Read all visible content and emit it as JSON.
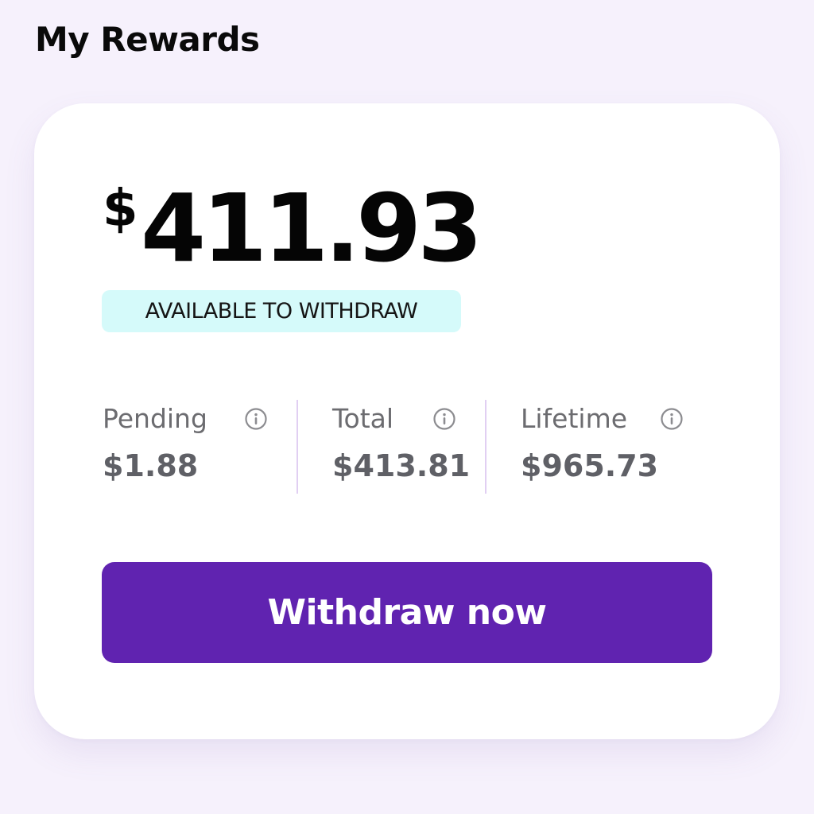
{
  "header": {
    "title": "My Rewards"
  },
  "rewards_card": {
    "balance": {
      "currency_symbol": "$",
      "amount": "411.93"
    },
    "available_label": "AVAILABLE TO WITHDRAW",
    "stats": [
      {
        "label": "Pending",
        "value": "$1.88",
        "icon": "info-icon"
      },
      {
        "label": "Total",
        "value": "$413.81",
        "icon": "info-icon"
      },
      {
        "label": "Lifetime",
        "value": "$965.73",
        "icon": "info-icon"
      }
    ],
    "withdraw_button_label": "Withdraw now"
  },
  "colors": {
    "page_background": "#f6f1fc",
    "card_background": "#ffffff",
    "badge_background": "#d5fafa",
    "divider": "#e1cff2",
    "primary_button": "#6023b0",
    "button_text": "#ffffff",
    "stat_label": "#6c6c70",
    "stat_value": "#5f6066"
  }
}
